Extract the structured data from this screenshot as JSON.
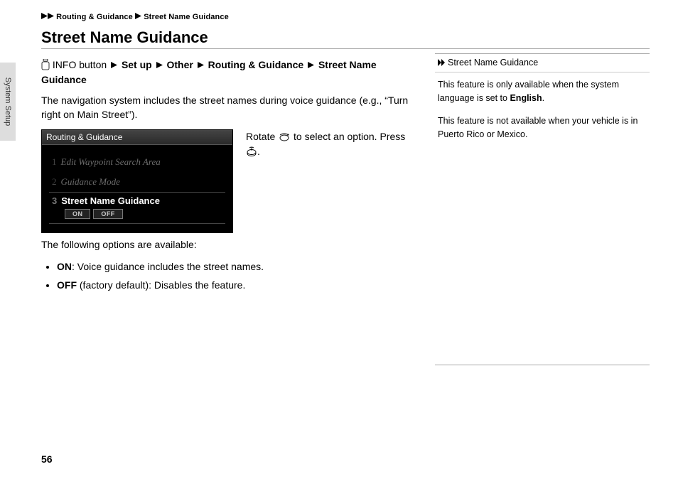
{
  "breadcrumb": {
    "a": "Routing & Guidance",
    "b": "Street Name Guidance"
  },
  "heading": "Street Name Guidance",
  "sidetab": "System Setup",
  "navpath": {
    "pre": "INFO button",
    "p1": "Set up",
    "p2": "Other",
    "p3": "Routing & Guidance",
    "p4": "Street Name Guidance"
  },
  "intro": "The navigation system includes the street names during voice guidance (e.g., “Turn right on Main Street”).",
  "screenshot": {
    "title": "Routing & Guidance",
    "row1": "Edit Waypoint Search Area",
    "row2": "Guidance Mode",
    "row3": "Street Name Guidance",
    "on": "ON",
    "off": "OFF"
  },
  "step": {
    "a": "Rotate ",
    "b": " to select an option. Press ",
    "c": "."
  },
  "follow": "The following options are available:",
  "opts": {
    "on_label": "ON",
    "on_text": ": Voice guidance includes the street names.",
    "off_label": "OFF",
    "off_text": " (factory default): Disables the feature."
  },
  "note": {
    "title": "Street Name Guidance",
    "p1a": "This feature is only available when the system language is set to ",
    "p1b": "English",
    "p1c": ".",
    "p2": "This feature is not available when your vehicle is in Puerto Rico or Mexico."
  },
  "pagenum": "56"
}
